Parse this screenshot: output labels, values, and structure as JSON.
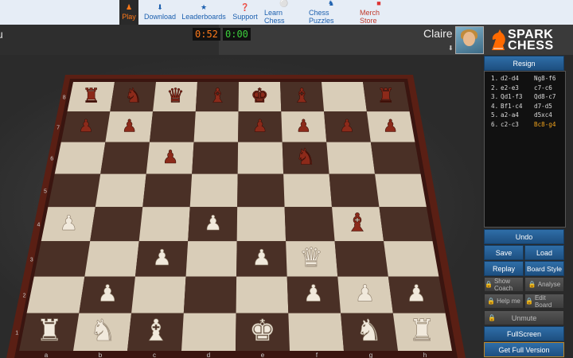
{
  "nav": {
    "items": [
      {
        "label": "Play",
        "icon": "pawn-icon",
        "active": true
      },
      {
        "label": "Download",
        "icon": "download-icon"
      },
      {
        "label": "Leaderboards",
        "icon": "trophy-icon"
      },
      {
        "label": "Support",
        "icon": "help-icon"
      },
      {
        "label": "Learn Chess",
        "icon": "lightbulb-icon"
      },
      {
        "label": "Chess Puzzles",
        "icon": "puzzle-icon"
      },
      {
        "label": "Merch Store",
        "icon": "shirt-icon"
      }
    ]
  },
  "opponent": {
    "name_fragment": "u",
    "clock": "0:52"
  },
  "player": {
    "name": "Claire",
    "clock": "0:00"
  },
  "logo": {
    "line1": "SPARK",
    "line2": "CHESS"
  },
  "board": {
    "files": [
      "a",
      "b",
      "c",
      "d",
      "e",
      "f",
      "g",
      "h"
    ],
    "ranks": [
      "1",
      "2",
      "3",
      "4",
      "5",
      "6",
      "7",
      "8"
    ],
    "pieces": [
      {
        "sq": "a8",
        "p": "bR"
      },
      {
        "sq": "b8",
        "p": "bN"
      },
      {
        "sq": "d8",
        "p": "bB"
      },
      {
        "sq": "e8",
        "p": "bK"
      },
      {
        "sq": "f8",
        "p": "bB"
      },
      {
        "sq": "h8",
        "p": "bR"
      },
      {
        "sq": "a7",
        "p": "bP"
      },
      {
        "sq": "b7",
        "p": "bP"
      },
      {
        "sq": "c8",
        "p": "bQ"
      },
      {
        "sq": "e7",
        "p": "bP"
      },
      {
        "sq": "f7",
        "p": "bP"
      },
      {
        "sq": "g7",
        "p": "bP"
      },
      {
        "sq": "h7",
        "p": "bP"
      },
      {
        "sq": "c6",
        "p": "bP"
      },
      {
        "sq": "f6",
        "p": "bN"
      },
      {
        "sq": "d4",
        "p": "bP"
      },
      {
        "sq": "g4",
        "p": "bB"
      },
      {
        "sq": "a4",
        "p": "wP"
      },
      {
        "sq": "d4w",
        "p": "wP"
      },
      {
        "sq": "c3",
        "p": "wP"
      },
      {
        "sq": "e3",
        "p": "wP"
      },
      {
        "sq": "f3",
        "p": "wQ"
      },
      {
        "sq": "b2",
        "p": "wP"
      },
      {
        "sq": "f2",
        "p": "wP"
      },
      {
        "sq": "g2",
        "p": "wP"
      },
      {
        "sq": "h2",
        "p": "wP"
      },
      {
        "sq": "a1",
        "p": "wR"
      },
      {
        "sq": "b1",
        "p": "wN"
      },
      {
        "sq": "c1",
        "p": "wB"
      },
      {
        "sq": "e1",
        "p": "wK"
      },
      {
        "sq": "g1",
        "p": "wN"
      },
      {
        "sq": "h1",
        "p": "wR"
      }
    ]
  },
  "buttons": {
    "resign": "Resign",
    "undo": "Undo",
    "save": "Save",
    "load": "Load",
    "replay": "Replay",
    "board_style": "Board Style",
    "show_coach": "Show Coach",
    "analyse": "Analyse",
    "help_me": "Help me",
    "edit_board": "Edit Board",
    "unmute": "Unmute",
    "fullscreen": "FullScreen",
    "get_full": "Get Full Version"
  },
  "moves": [
    {
      "n": "1.",
      "w": "d2-d4",
      "b": "Ng8-f6"
    },
    {
      "n": "2.",
      "w": "e2-e3",
      "b": "c7-c6"
    },
    {
      "n": "3.",
      "w": "Qd1-f3",
      "b": "Qd8-c7"
    },
    {
      "n": "4.",
      "w": "Bf1-c4",
      "b": "d7-d5"
    },
    {
      "n": "5.",
      "w": "a2-a4",
      "b": "d5xc4"
    },
    {
      "n": "6.",
      "w": "c2-c3",
      "b": "Bc8-g4",
      "highlight": true
    }
  ],
  "colors": {
    "accent": "#ff7a1a",
    "nav_text": "#1b5fae",
    "clock_opponent": "#ff7a1a",
    "clock_player": "#3ccf3c",
    "button": "#2f6ea8",
    "highlight_move": "#f0a21c"
  }
}
